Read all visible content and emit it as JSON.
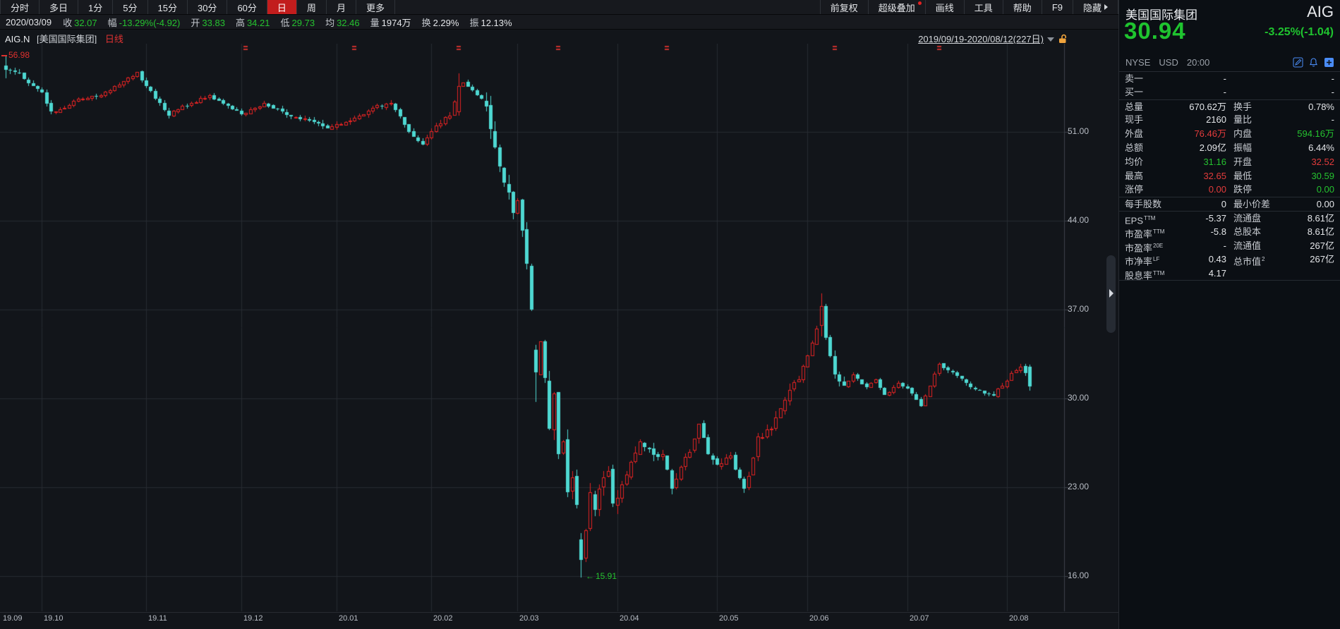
{
  "menus": {
    "periods": [
      "分时",
      "多日",
      "1分",
      "5分",
      "15分",
      "30分",
      "60分",
      "日",
      "周",
      "月",
      "更多"
    ],
    "selected_period": "日",
    "right_items": [
      {
        "label": "前复权"
      },
      {
        "label": "超级叠加",
        "badge": true
      },
      {
        "label": "画线"
      },
      {
        "label": "工具"
      },
      {
        "label": "帮助"
      },
      {
        "label": "F9"
      },
      {
        "label": "隐藏",
        "arrow": true
      }
    ]
  },
  "info_bar": {
    "date": "2020/03/09",
    "pairs": [
      {
        "label": "收",
        "value": "32.07",
        "c": "g"
      },
      {
        "label": "幅",
        "value": "-13.29%(-4.92)",
        "c": "g"
      },
      {
        "label": "开",
        "value": "33.83",
        "c": "g"
      },
      {
        "label": "高",
        "value": "34.21",
        "c": "g"
      },
      {
        "label": "低",
        "value": "29.73",
        "c": "g"
      },
      {
        "label": "均",
        "value": "32.46",
        "c": "g"
      },
      {
        "label": "量",
        "value": "1974万",
        "c": "w"
      },
      {
        "label": "换",
        "value": "2.29%",
        "c": "w"
      },
      {
        "label": "振",
        "value": "12.13%",
        "c": "w"
      }
    ]
  },
  "chart": {
    "header": {
      "symbol": "AIG.N",
      "name": "[美国国际集团]",
      "period": "日线",
      "range": "2019/09/19-2020/08/12(227日)"
    },
    "annotations": {
      "high": "56.98",
      "low": "15.91"
    },
    "colors": {
      "up": "#e32222",
      "down": "#4ed8d2",
      "grid": "#262a30",
      "axis": "#3c414a",
      "mark": "#c9302c"
    }
  },
  "chart_data": {
    "type": "candlestick",
    "symbol": "AIG.N",
    "title": "美国国际集团 日线",
    "period": "daily",
    "date_range": "2019/09/19-2020/08/12",
    "sessions": 227,
    "price_high": 56.98,
    "price_low": 15.91,
    "y_ticks": [
      51,
      44,
      37,
      30,
      23,
      16
    ],
    "months": [
      {
        "label": "19.09",
        "day": 0
      },
      {
        "label": "19.10",
        "day": 8
      },
      {
        "label": "19.11",
        "day": 31
      },
      {
        "label": "19.12",
        "day": 52
      },
      {
        "label": "20.01",
        "day": 73
      },
      {
        "label": "20.02",
        "day": 94
      },
      {
        "label": "20.03",
        "day": 113
      },
      {
        "label": "20.04",
        "day": 135
      },
      {
        "label": "20.05",
        "day": 157
      },
      {
        "label": "20.06",
        "day": 177
      },
      {
        "label": "20.07",
        "day": 199
      },
      {
        "label": "20.08",
        "day": 221
      }
    ],
    "anchors": [
      [
        0,
        55.9
      ],
      [
        3,
        55.6
      ],
      [
        6,
        54.6
      ],
      [
        8,
        54.1
      ],
      [
        10,
        52.6
      ],
      [
        13,
        52.9
      ],
      [
        16,
        53.6
      ],
      [
        20,
        53.8
      ],
      [
        23,
        54.3
      ],
      [
        26,
        55.0
      ],
      [
        29,
        55.7
      ],
      [
        31,
        54.6
      ],
      [
        33,
        53.6
      ],
      [
        36,
        52.3
      ],
      [
        38,
        52.8
      ],
      [
        41,
        53.3
      ],
      [
        45,
        53.9
      ],
      [
        48,
        53.2
      ],
      [
        52,
        52.4
      ],
      [
        55,
        52.9
      ],
      [
        57,
        53.3
      ],
      [
        60,
        52.8
      ],
      [
        63,
        52.2
      ],
      [
        67,
        51.9
      ],
      [
        71,
        51.3
      ],
      [
        74,
        51.6
      ],
      [
        77,
        52.1
      ],
      [
        81,
        52.9
      ],
      [
        85,
        53.3
      ],
      [
        87,
        52.2
      ],
      [
        89,
        51.0
      ],
      [
        92,
        50.0
      ],
      [
        95,
        51.5
      ],
      [
        98,
        52.3
      ],
      [
        100,
        54.6
      ],
      [
        101,
        54.9
      ],
      [
        103,
        54.3
      ],
      [
        105,
        53.6
      ],
      [
        106,
        53.0
      ],
      [
        107,
        51.2
      ],
      [
        108,
        49.8
      ],
      [
        109,
        48.3
      ],
      [
        110,
        47.0
      ],
      [
        111,
        46.2
      ],
      [
        112,
        44.6
      ],
      [
        113,
        45.6
      ],
      [
        114,
        43.2
      ],
      [
        115,
        40.6
      ],
      [
        116,
        36.99
      ],
      [
        117,
        32.07
      ],
      [
        118,
        34.5
      ],
      [
        119,
        31.6
      ],
      [
        120,
        27.6
      ],
      [
        121,
        30.4
      ],
      [
        122,
        25.6
      ],
      [
        123,
        26.6
      ],
      [
        124,
        22.6
      ],
      [
        125,
        23.8
      ],
      [
        126,
        21.6
      ],
      [
        127,
        17.3
      ],
      [
        128,
        19.6
      ],
      [
        129,
        22.6
      ],
      [
        130,
        21.2
      ],
      [
        131,
        22.9
      ],
      [
        132,
        23.8
      ],
      [
        133,
        24.3
      ],
      [
        134,
        21.7
      ],
      [
        136,
        23.2
      ],
      [
        138,
        25.0
      ],
      [
        140,
        26.6
      ],
      [
        142,
        26.0
      ],
      [
        144,
        25.4
      ],
      [
        145,
        25.6
      ],
      [
        147,
        22.9
      ],
      [
        149,
        24.6
      ],
      [
        151,
        25.8
      ],
      [
        153,
        28.0
      ],
      [
        155,
        25.6
      ],
      [
        157,
        24.8
      ],
      [
        160,
        25.5
      ],
      [
        163,
        22.9
      ],
      [
        164,
        23.9
      ],
      [
        166,
        27.0
      ],
      [
        169,
        27.6
      ],
      [
        172,
        29.9
      ],
      [
        174,
        31.3
      ],
      [
        175,
        31.5
      ],
      [
        177,
        33.4
      ],
      [
        179,
        35.5
      ],
      [
        180,
        37.3
      ],
      [
        181,
        34.8
      ],
      [
        183,
        31.9
      ],
      [
        185,
        31.0
      ],
      [
        187,
        31.9
      ],
      [
        190,
        30.9
      ],
      [
        192,
        31.5
      ],
      [
        194,
        30.3
      ],
      [
        197,
        31.2
      ],
      [
        199,
        30.8
      ],
      [
        202,
        29.4
      ],
      [
        204,
        31.0
      ],
      [
        206,
        32.7
      ],
      [
        208,
        32.2
      ],
      [
        210,
        31.8
      ],
      [
        212,
        31.2
      ],
      [
        214,
        30.7
      ],
      [
        216,
        30.4
      ],
      [
        218,
        30.2
      ],
      [
        219,
        30.8
      ],
      [
        221,
        31.4
      ],
      [
        222,
        32.0
      ],
      [
        224,
        32.5
      ],
      [
        225,
        31.98
      ],
      [
        226,
        30.94
      ]
    ],
    "special": {
      "0": {
        "o": 56.2,
        "h": 56.98,
        "l": 55.2,
        "c": 55.9
      },
      "100": {
        "o": 52.6,
        "h": 55.62,
        "l": 52.3,
        "c": 54.6
      },
      "117": {
        "o": 33.83,
        "h": 34.21,
        "l": 29.73,
        "c": 32.07
      },
      "127": {
        "o": 18.9,
        "h": 19.4,
        "l": 15.91,
        "c": 17.3
      },
      "180": {
        "o": 35.8,
        "h": 38.28,
        "l": 34.9,
        "c": 37.3
      },
      "226": {
        "o": 32.52,
        "h": 32.65,
        "l": 30.59,
        "c": 30.94
      }
    },
    "event_mark_days": [
      53,
      77,
      100,
      122,
      146,
      183,
      206
    ]
  },
  "panel": {
    "title": "美国国际集团",
    "symbol": "AIG",
    "price": "30.94",
    "change": "-3.25%(-1.04)",
    "exchange": "NYSE",
    "currency": "USD",
    "time": "20:00",
    "icon_names": [
      "pencil-icon",
      "bell-icon",
      "plus-icon"
    ],
    "rows": [
      {
        "l1": {
          "t": "卖一"
        },
        "v1": {
          "t": "-",
          "c": "w"
        },
        "l2": {
          "t": ""
        },
        "v2": {
          "t": "-",
          "c": "w"
        },
        "grp": true
      },
      {
        "l1": {
          "t": "买一"
        },
        "v1": {
          "t": "-",
          "c": "w"
        },
        "l2": {
          "t": ""
        },
        "v2": {
          "t": "-",
          "c": "w"
        }
      },
      {
        "l1": {
          "t": "总量"
        },
        "v1": {
          "t": "670.62万",
          "c": "w"
        },
        "l2": {
          "t": "换手"
        },
        "v2": {
          "t": "0.78%",
          "c": "w"
        },
        "grp": true
      },
      {
        "l1": {
          "t": "现手"
        },
        "v1": {
          "t": "2160",
          "c": "w"
        },
        "l2": {
          "t": "量比"
        },
        "v2": {
          "t": "-",
          "c": "w"
        }
      },
      {
        "l1": {
          "t": "外盘"
        },
        "v1": {
          "t": "76.46万",
          "c": "r"
        },
        "l2": {
          "t": "内盘"
        },
        "v2": {
          "t": "594.16万",
          "c": "g"
        }
      },
      {
        "l1": {
          "t": "总额"
        },
        "v1": {
          "t": "2.09亿",
          "c": "w"
        },
        "l2": {
          "t": "振幅"
        },
        "v2": {
          "t": "6.44%",
          "c": "w"
        }
      },
      {
        "l1": {
          "t": "均价"
        },
        "v1": {
          "t": "31.16",
          "c": "g"
        },
        "l2": {
          "t": "开盘"
        },
        "v2": {
          "t": "32.52",
          "c": "r"
        }
      },
      {
        "l1": {
          "t": "最高"
        },
        "v1": {
          "t": "32.65",
          "c": "r"
        },
        "l2": {
          "t": "最低"
        },
        "v2": {
          "t": "30.59",
          "c": "g"
        }
      },
      {
        "l1": {
          "t": "涨停"
        },
        "v1": {
          "t": "0.00",
          "c": "r"
        },
        "l2": {
          "t": "跌停"
        },
        "v2": {
          "t": "0.00",
          "c": "g"
        }
      },
      {
        "l1": {
          "t": "每手股数"
        },
        "v1": {
          "t": "0",
          "c": "w"
        },
        "l2": {
          "t": "最小价差"
        },
        "v2": {
          "t": "0.00",
          "c": "w"
        },
        "grp": true
      },
      {
        "l1": {
          "t": "EPS",
          "sup": "TTM"
        },
        "v1": {
          "t": "-5.37",
          "c": "w"
        },
        "l2": {
          "t": "流通盘"
        },
        "v2": {
          "t": "8.61亿",
          "c": "w"
        },
        "grp": true
      },
      {
        "l1": {
          "t": "市盈率",
          "sup": "TTM"
        },
        "v1": {
          "t": "-5.8",
          "c": "w"
        },
        "l2": {
          "t": "总股本"
        },
        "v2": {
          "t": "8.61亿",
          "c": "w"
        }
      },
      {
        "l1": {
          "t": "市盈率",
          "sup": "20E"
        },
        "v1": {
          "t": "-",
          "c": "w"
        },
        "l2": {
          "t": "流通值"
        },
        "v2": {
          "t": "267亿",
          "c": "w"
        }
      },
      {
        "l1": {
          "t": "市净率",
          "sup": "LF"
        },
        "v1": {
          "t": "0.43",
          "c": "w"
        },
        "l2": {
          "t": "总市值",
          "sup": "2"
        },
        "v2": {
          "t": "267亿",
          "c": "w"
        }
      },
      {
        "l1": {
          "t": "股息率",
          "sup": "TTM"
        },
        "v1": {
          "t": "4.17",
          "c": "w"
        },
        "l2": {
          "t": ""
        },
        "v2": {
          "t": "",
          "c": "w"
        },
        "end": true
      }
    ]
  }
}
